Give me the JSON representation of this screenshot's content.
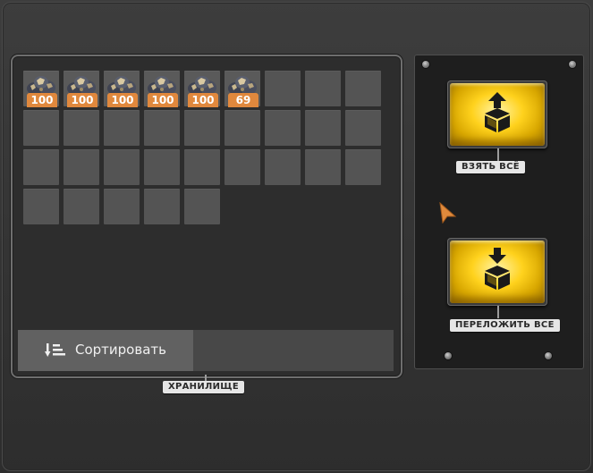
{
  "storage": {
    "label": "ХРАНИЛИЩЕ",
    "columns": 9,
    "total_slots": 32,
    "items": [
      {
        "name": "ore-stack-icon",
        "count": "100"
      },
      {
        "name": "ore-stack-icon",
        "count": "100"
      },
      {
        "name": "ore-stack-icon",
        "count": "100"
      },
      {
        "name": "ore-stack-icon",
        "count": "100"
      },
      {
        "name": "ore-stack-icon",
        "count": "100"
      },
      {
        "name": "ore-stack-icon",
        "count": "69"
      }
    ],
    "sort_label": "Сортировать",
    "sort_icon": "sort-descending-icon"
  },
  "actions": {
    "take_all_label": "ВЗЯТЬ ВСЁ",
    "take_all_icon": "box-arrow-up-icon",
    "move_all_label": "ПЕРЕЛОЖИТЬ ВСЕ",
    "move_all_icon": "box-arrow-down-icon"
  },
  "colors": {
    "count_badge": "#e0883d",
    "button_gold": "#ffd21d",
    "slot": "#545454",
    "panel": "#2d2d2d"
  }
}
